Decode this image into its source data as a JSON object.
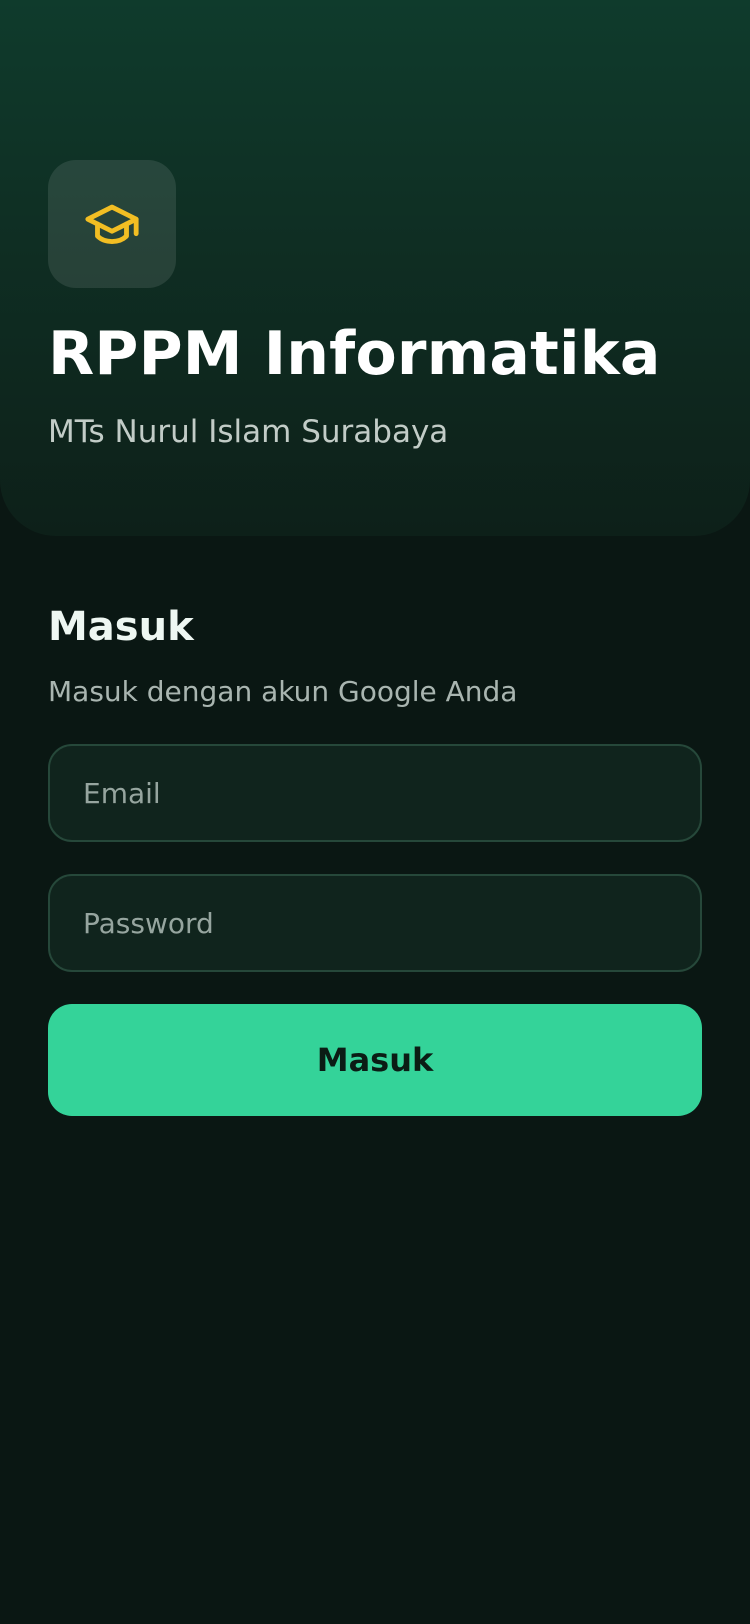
{
  "header": {
    "logo_icon": "graduation-cap-icon",
    "logo_icon_color": "#f2be23",
    "title": "RPPM Informatika",
    "subtitle": "MTs Nurul Islam Surabaya"
  },
  "login": {
    "heading": "Masuk",
    "description": "Masuk dengan akun Google Anda",
    "email_placeholder": "Email",
    "password_placeholder": "Password",
    "submit_label": "Masuk"
  },
  "colors": {
    "accent": "#34d399",
    "background": "#0a1713",
    "hero": "#0f3b2c"
  }
}
